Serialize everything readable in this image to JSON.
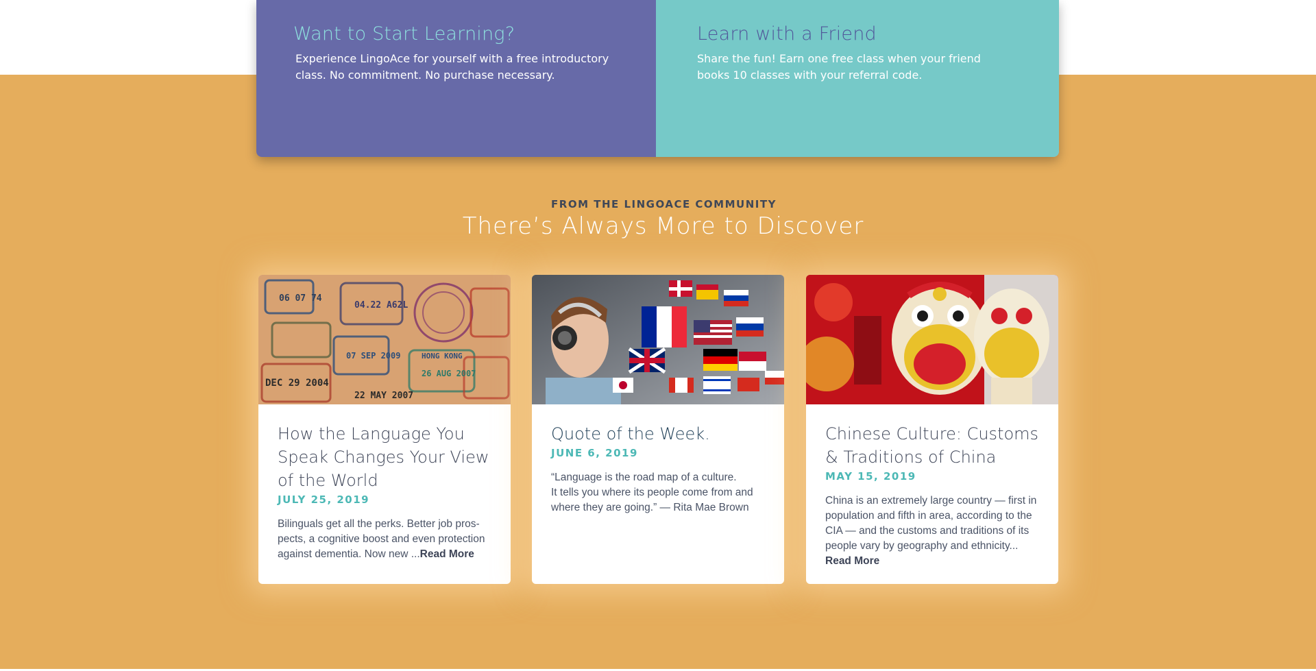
{
  "promo": {
    "left": {
      "title": "Want to Start Learning?",
      "text": "Experience LingoAce for yourself with a free introductory class. No commitment. No purchase necessary."
    },
    "right": {
      "title": "Learn with a Friend",
      "text": "Share the fun! Earn one free class when your friend books 10 classes with your referral code."
    }
  },
  "community": {
    "eyebrow": "FROM THE LINGOACE COMMUNITY",
    "title": "There’s Always More to Discover"
  },
  "cards": [
    {
      "title": "How the Language You Speak Changes Your View of the World",
      "date": "JULY 25, 2019",
      "excerpt": "Bilinguals get all the perks. Better job pros-pects, a cognitive boost and even protection against dementia. Now new ...",
      "read_more": "Read More"
    },
    {
      "title": "Quote of the Week.",
      "date": "JUNE 6, 2019",
      "quote_line1": "“Language is the road map of a culture.",
      "quote_line2": "It tells you where its people come from and where they are going.”  —  Rita Mae Brown"
    },
    {
      "title": "Chinese Culture: Customs & Traditions of China",
      "date": "MAY 15, 2019",
      "excerpt": "China is an extremely large country — first in population and fifth in area, according to the CIA — and the customs and traditions of its people vary by geography and ethnicity...",
      "read_more": "Read More"
    }
  ],
  "colors": {
    "background": "#e5ad5c",
    "promo_left": "#676aa8",
    "promo_right": "#76c9c8",
    "date_accent": "#4cb8b5"
  }
}
